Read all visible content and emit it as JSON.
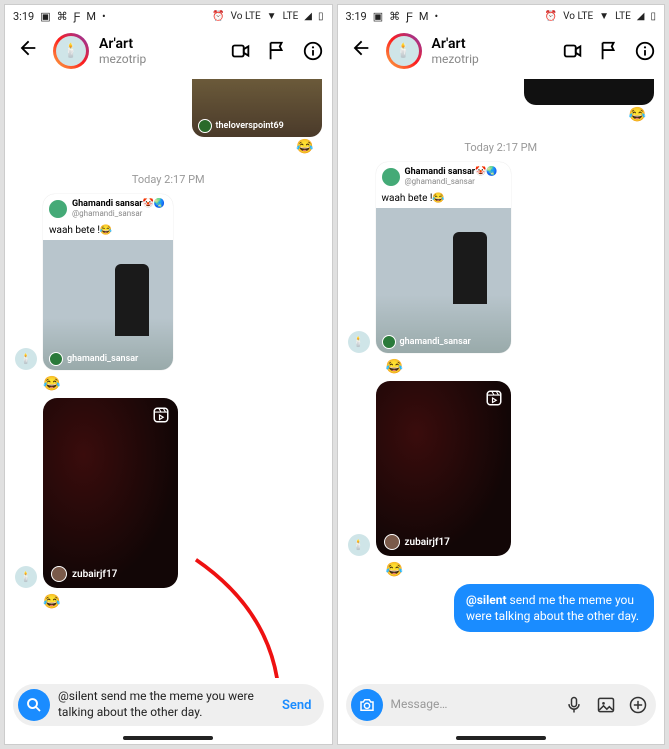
{
  "status": {
    "time": "3:19",
    "lte": "LTE",
    "volte": "Vo LTE"
  },
  "header": {
    "name": "Ar'art",
    "subtitle": "mezotrip"
  },
  "ts": "Today 2:17 PM",
  "post": {
    "name": "Ghamandi sansar",
    "handle": "@ghamandi_sansar",
    "caption": "waah bete !😂",
    "overlay": "ghamandi_sansar"
  },
  "partial_overlay": "theloverspoint69",
  "reel": {
    "user": "zubairjf17"
  },
  "react_emoji": "😂",
  "left_input": {
    "text": "@silent send me the meme you were talking about the other day.",
    "send": "Send"
  },
  "right_sent": {
    "mention": "@silent",
    "rest": " send me the meme you were talking about the other day."
  },
  "right_input": {
    "placeholder": "Message…"
  }
}
